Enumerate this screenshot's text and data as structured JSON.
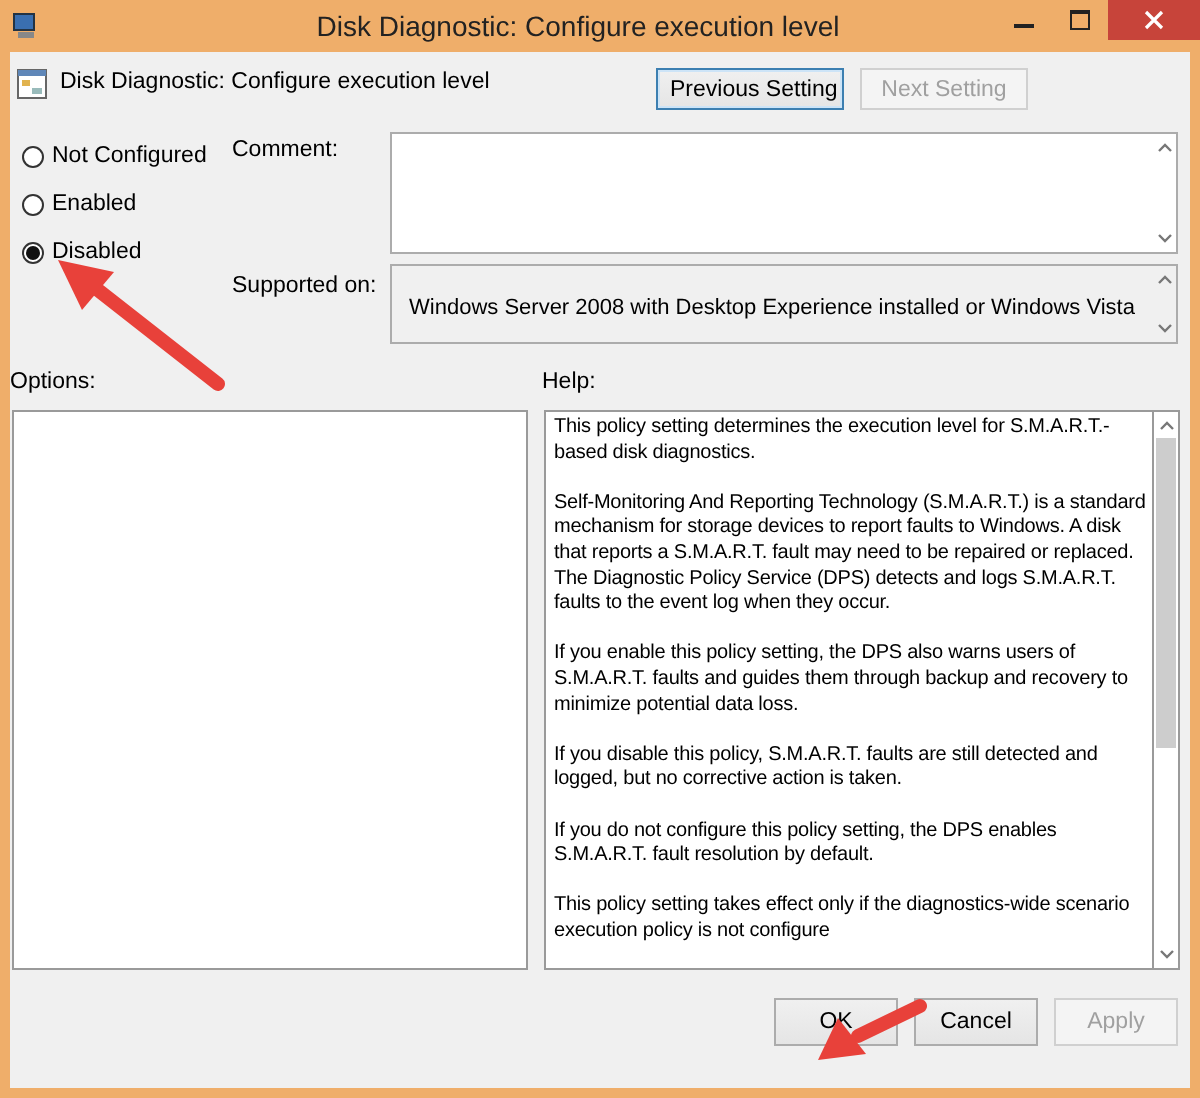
{
  "window": {
    "title": "Disk Diagnostic: Configure execution level"
  },
  "header": {
    "title": "Disk Diagnostic: Configure execution level"
  },
  "nav_buttons": [
    {
      "label": "Previous Setting",
      "disabled": false
    },
    {
      "label": "Next Setting",
      "disabled": true
    }
  ],
  "state_options": [
    {
      "label": "Not Configured",
      "selected": false
    },
    {
      "label": "Enabled",
      "selected": false
    },
    {
      "label": "Disabled",
      "selected": true
    }
  ],
  "comment": {
    "label": "Comment:"
  },
  "supported_on": {
    "label": "Supported on:",
    "value": "Windows Server 2008 with Desktop Experience installed or Windows Vista"
  },
  "options": {
    "label": "Options:"
  },
  "help": {
    "label": "Help:",
    "paragraphs": [
      "This policy setting determines the execution level for S.M.A.R.T.-based disk diagnostics.",
      "Self-Monitoring And Reporting Technology (S.M.A.R.T.) is a standard mechanism for storage devices to report faults to Windows. A disk that reports a S.M.A.R.T. fault may need to be repaired or replaced. The Diagnostic Policy Service (DPS) detects and logs S.M.A.R.T. faults to the event log when they occur.",
      "If you enable this policy setting, the DPS also warns users of S.M.A.R.T. faults and guides them through backup and recovery to minimize potential data loss.",
      "If you disable this policy, S.M.A.R.T. faults are still detected and logged, but no corrective action is taken.",
      "If you do not configure this policy setting, the DPS enables S.M.A.R.T. fault resolution by default.",
      "This policy setting takes effect only if the diagnostics-wide scenario execution policy is not configure"
    ]
  },
  "footer_buttons": [
    {
      "label": "OK",
      "disabled": false
    },
    {
      "label": "Cancel",
      "disabled": false
    },
    {
      "label": "Apply",
      "disabled": true
    }
  ]
}
